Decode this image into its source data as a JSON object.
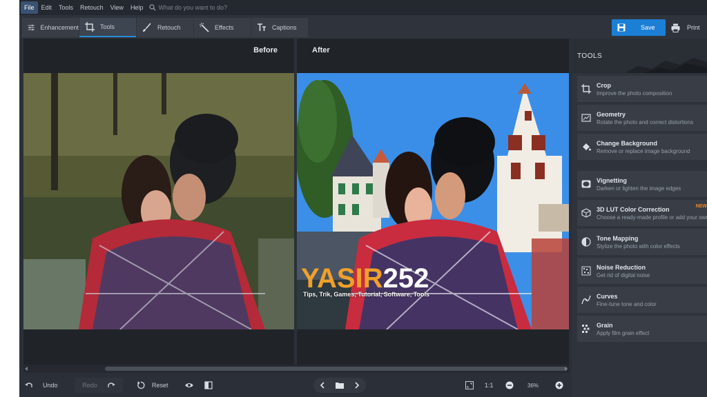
{
  "menubar": {
    "items": [
      "File",
      "Edit",
      "Tools",
      "Retouch",
      "View",
      "Help"
    ],
    "search_placeholder": "What do you want to do?"
  },
  "toolbar": {
    "tabs": [
      {
        "label": "Enhancement",
        "icon": "sliders-icon"
      },
      {
        "label": "Tools",
        "icon": "crop-icon",
        "active": true
      },
      {
        "label": "Retouch",
        "icon": "brush-icon"
      },
      {
        "label": "Effects",
        "icon": "magic-wand-icon"
      },
      {
        "label": "Captions",
        "icon": "text-icon"
      }
    ],
    "save_label": "Save",
    "print_label": "Print"
  },
  "canvas": {
    "before_label": "Before",
    "after_label": "After",
    "watermark_part1": "YASIR",
    "watermark_part2": "252",
    "watermark_tagline": "Tips, Trik, Games, Tutorial, Software, Tools"
  },
  "bottombar": {
    "undo_label": "Undo",
    "redo_label": "Redo",
    "reset_label": "Reset",
    "one_to_one": "1:1",
    "zoom_value": "36%"
  },
  "tools_panel": {
    "title": "TOOLS",
    "items": [
      {
        "name": "Crop",
        "desc": "Improve the photo composition",
        "icon": "crop-icon"
      },
      {
        "name": "Geometry",
        "desc": "Rotate the photo and correct distortions",
        "icon": "geometry-icon"
      },
      {
        "name": "Change Background",
        "desc": "Remove or replace image background",
        "icon": "paint-bucket-icon"
      },
      {
        "name": "Vignetting",
        "desc": "Darken or lighten the image edges",
        "icon": "vignette-icon"
      },
      {
        "name": "3D LUT Color Correction",
        "desc": "Choose a ready-made profile or add your own",
        "icon": "cube-icon",
        "badge": "NEW"
      },
      {
        "name": "Tone Mapping",
        "desc": "Stylize the photo with color effects",
        "icon": "tone-icon"
      },
      {
        "name": "Noise Reduction",
        "desc": "Get rid of digital noise",
        "icon": "noise-icon"
      },
      {
        "name": "Curves",
        "desc": "Fine-tune tone and color",
        "icon": "curves-icon"
      },
      {
        "name": "Grain",
        "desc": "Apply film grain effect",
        "icon": "grain-icon"
      }
    ]
  },
  "colors": {
    "accent": "#1c7fd6",
    "panel_bg": "#2f343c",
    "watermark_orange": "#f0a02a",
    "new_badge": "#f08a28"
  }
}
